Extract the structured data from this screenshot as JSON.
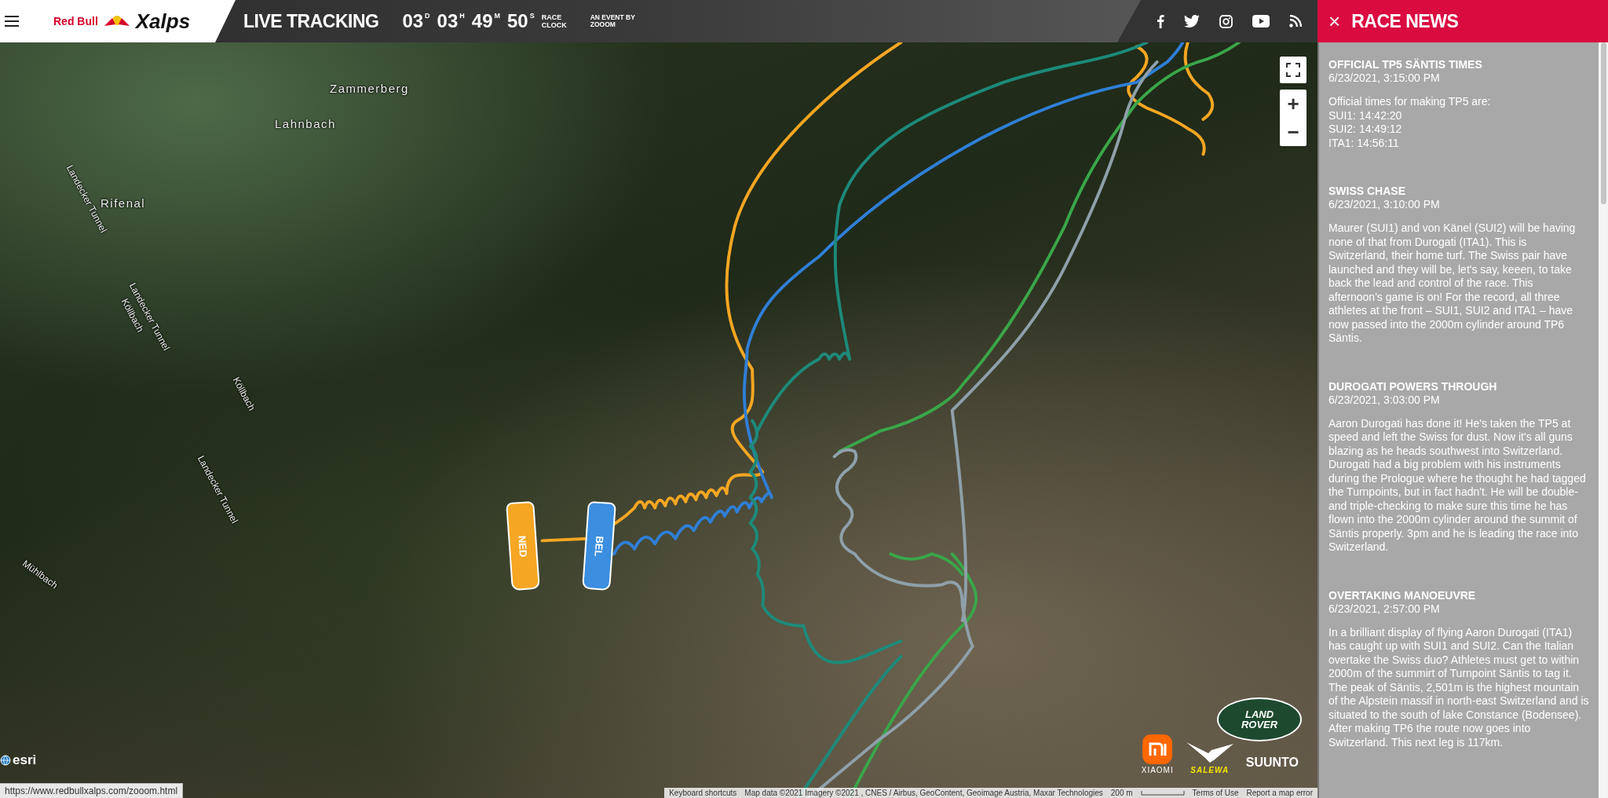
{
  "header": {
    "logo": {
      "brand": "Red Bull",
      "name": "Xalps"
    },
    "title": "LIVE TRACKING",
    "clock": [
      {
        "value": "03",
        "unit": "D"
      },
      {
        "value": "03",
        "unit": "H"
      },
      {
        "value": "49",
        "unit": "M"
      },
      {
        "value": "50",
        "unit": "S"
      }
    ],
    "clock_label": [
      "RACE",
      "CLOCK"
    ],
    "event_by": "AN EVENT BY",
    "organizer": "ZOOOM",
    "social": [
      {
        "kind": "facebook"
      },
      {
        "kind": "twitter"
      },
      {
        "kind": "instagram"
      },
      {
        "kind": "youtube"
      },
      {
        "kind": "rss"
      }
    ]
  },
  "news_panel": {
    "close": "×",
    "title": "RACE NEWS",
    "items": [
      {
        "headline": "OFFICIAL TP5 SÄNTIS TIMES",
        "date": "6/23/2021, 3:15:00 PM",
        "body": "Official times for making TP5 are:\nSUI1: 14:42:20\nSUI2: 14:49:12\nITA1: 14:56:11"
      },
      {
        "headline": "SWISS CHASE",
        "date": "6/23/2021, 3:10:00 PM",
        "body": "Maurer (SUI1) and von Känel (SUI2) will be having none of that from Durogati (ITA1). This is Switzerland, their home turf. The Swiss pair have launched and they will be, let's say, keeen, to take back the lead and control of the race. This afternoon's game is on! For the record, all three athletes at the front – SUI1, SUI2 and ITA1 – have now passed into the 2000m cylinder around TP6 Säntis."
      },
      {
        "headline": "DUROGATI POWERS THROUGH",
        "date": "6/23/2021, 3:03:00 PM",
        "body": "Aaron Durogati has done it! He's taken the TP5 at speed and left the Swiss for dust. Now it's all guns blazing as he heads southwest into Switzerland. Durogati had a big problem with his instruments during the Prologue where he thought he had tagged the Turnpoints, but in fact hadn't. He will be double- and triple-checking to make sure this time he has flown into the 2000m cylinder around the summit of Säntis properly. 3pm and he is leading the race into Switzerland."
      },
      {
        "headline": "OVERTAKING MANOEUVRE",
        "date": "6/23/2021, 2:57:00 PM",
        "body": "In a brilliant display of flying Aaron Durogati (ITA1) has caught up with SUI1 and SUI2. Can the Italian overtake the Swiss duo? Athletes must get to within 2000m of the summirt of Turnpoint Säntis to tag it. The peak of Säntis, 2,501m is the highest mountain of the Alpstein massif in north-east Switzerland and is situated to the south of lake Constance (Bodensee). After making TP6 the route now goes into Switzerland. This next leg is 117km."
      }
    ]
  },
  "map": {
    "labels": [
      "Zammerberg",
      "Lahnbach",
      "Rifenal",
      "Landecker Tunnel",
      "Landecker Tunnel",
      "Landecker Tunnel",
      "Köllbach",
      "Köllbach",
      "Mühlbach"
    ],
    "zoom_in": "+",
    "zoom_out": "−",
    "gliders": [
      {
        "label": "NED",
        "color": "#f5a623"
      },
      {
        "label": "BEL",
        "color": "#3b8ee0"
      }
    ],
    "sponsors": {
      "land_rover": [
        "LAND",
        "ROVER"
      ],
      "xiaomi": "XIAOMI",
      "salewa": "SALEWA",
      "suunto": "SUUNTO"
    },
    "esri": "esri",
    "attribution": [
      "Keyboard shortcuts",
      "Map data ©2021 Imagery ©2021 , CNES / Airbus, GeoContent, Geoimage Austria, Maxar Technologies",
      "200 m",
      "Terms of Use",
      "Report a map error"
    ],
    "status_url": "https://www.redbullxalps.com/zooom.html"
  }
}
